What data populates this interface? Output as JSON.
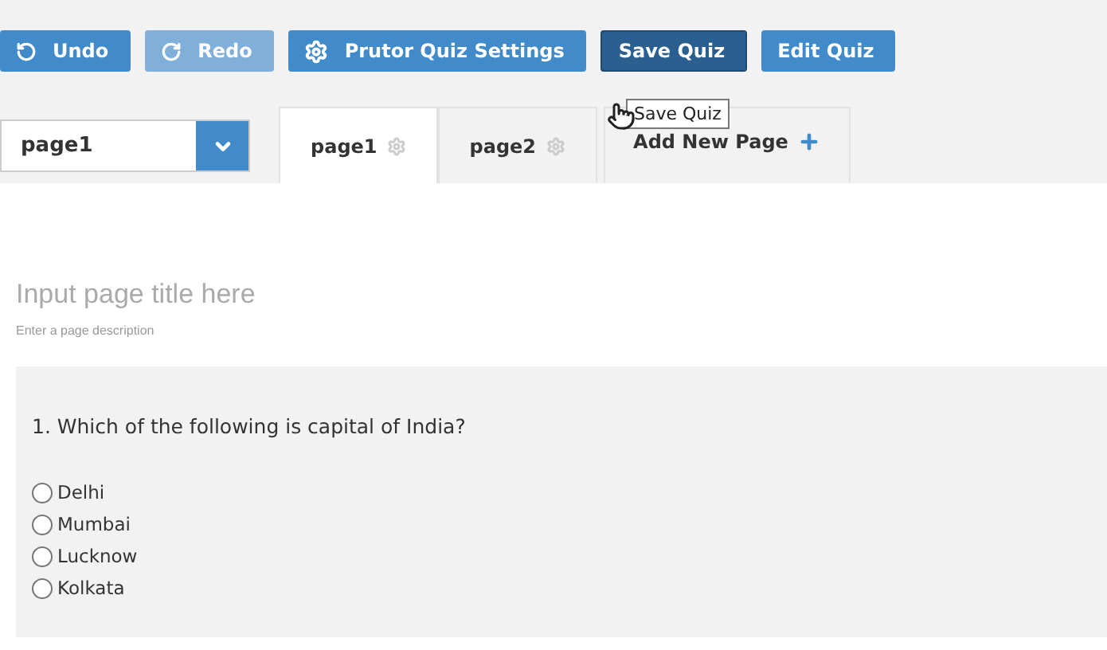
{
  "toolbar": [
    {
      "label": "Undo",
      "kind": "undo",
      "disabled": false,
      "hovered": false
    },
    {
      "label": "Redo",
      "kind": "redo",
      "disabled": true,
      "hovered": false
    },
    {
      "label": "Prutor Quiz Settings",
      "kind": "settings",
      "disabled": false,
      "hovered": false
    },
    {
      "label": "Save Quiz",
      "kind": "plain",
      "disabled": false,
      "hovered": true
    },
    {
      "label": "Edit Quiz",
      "kind": "plain",
      "disabled": false,
      "hovered": false
    }
  ],
  "tooltip": "Save Quiz",
  "page_select": {
    "value": "page1"
  },
  "tabs": [
    {
      "label": "page1",
      "kind": "page",
      "selected": true
    },
    {
      "label": "page2",
      "kind": "page",
      "selected": false
    },
    {
      "label": "Add New Page",
      "kind": "add",
      "selected": false
    }
  ],
  "page_title": {
    "placeholder": "Input page title here"
  },
  "page_description": {
    "placeholder": "Enter a page description"
  },
  "question": {
    "text": "1. Which of the following is capital of India?",
    "options": [
      {
        "label": "Delhi",
        "selected": false
      },
      {
        "label": "Mumbai",
        "selected": false
      },
      {
        "label": "Lucknow",
        "selected": false
      },
      {
        "label": "Kolkata",
        "selected": false
      }
    ]
  }
}
